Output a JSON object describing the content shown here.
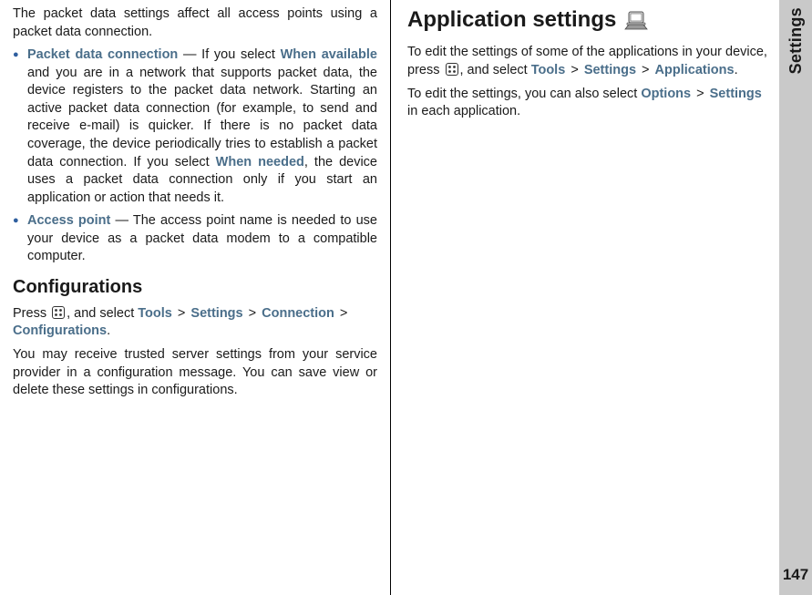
{
  "sidebar": {
    "title": "Settings",
    "page_number": "147"
  },
  "left": {
    "intro": "The packet data settings affect all access points using a packet data connection.",
    "bullets": [
      {
        "term": "Packet data connection",
        "dash": " — If you select ",
        "opt1": "When available",
        "mid": " and you are in a network that supports packet data, the device registers to the packet data network. Starting an active packet data connection (for example, to send and receive e-mail) is quicker. If there is no packet data coverage, the device periodically tries to establish a packet data connection. If you select ",
        "opt2": "When needed",
        "tail": ", the device uses a packet data connection only if you start an application or action that needs it."
      },
      {
        "term": "Access point",
        "dash": "  — The access point name is needed to use your device as a packet data modem to a compatible computer.",
        "opt1": "",
        "mid": "",
        "opt2": "",
        "tail": ""
      }
    ],
    "configs": {
      "heading": "Configurations",
      "press": "Press ",
      "select": ", and select ",
      "path": [
        "Tools",
        "Settings",
        "Connection",
        "Configurations"
      ],
      "gt": ">",
      "dot": ".",
      "body": "You may receive trusted server settings from your service provider in a configuration message. You can save view or delete these settings in configurations."
    }
  },
  "right": {
    "heading": "Application settings",
    "p1a": "To edit the settings of some of the applications in your device, press ",
    "p1b": ", and select ",
    "path1": [
      "Tools",
      "Settings",
      "Applications"
    ],
    "gt": ">",
    "dot": ".",
    "p2a": "To edit the settings, you can also select ",
    "p2path": [
      "Options",
      "Settings"
    ],
    "p2b": " in each application."
  }
}
